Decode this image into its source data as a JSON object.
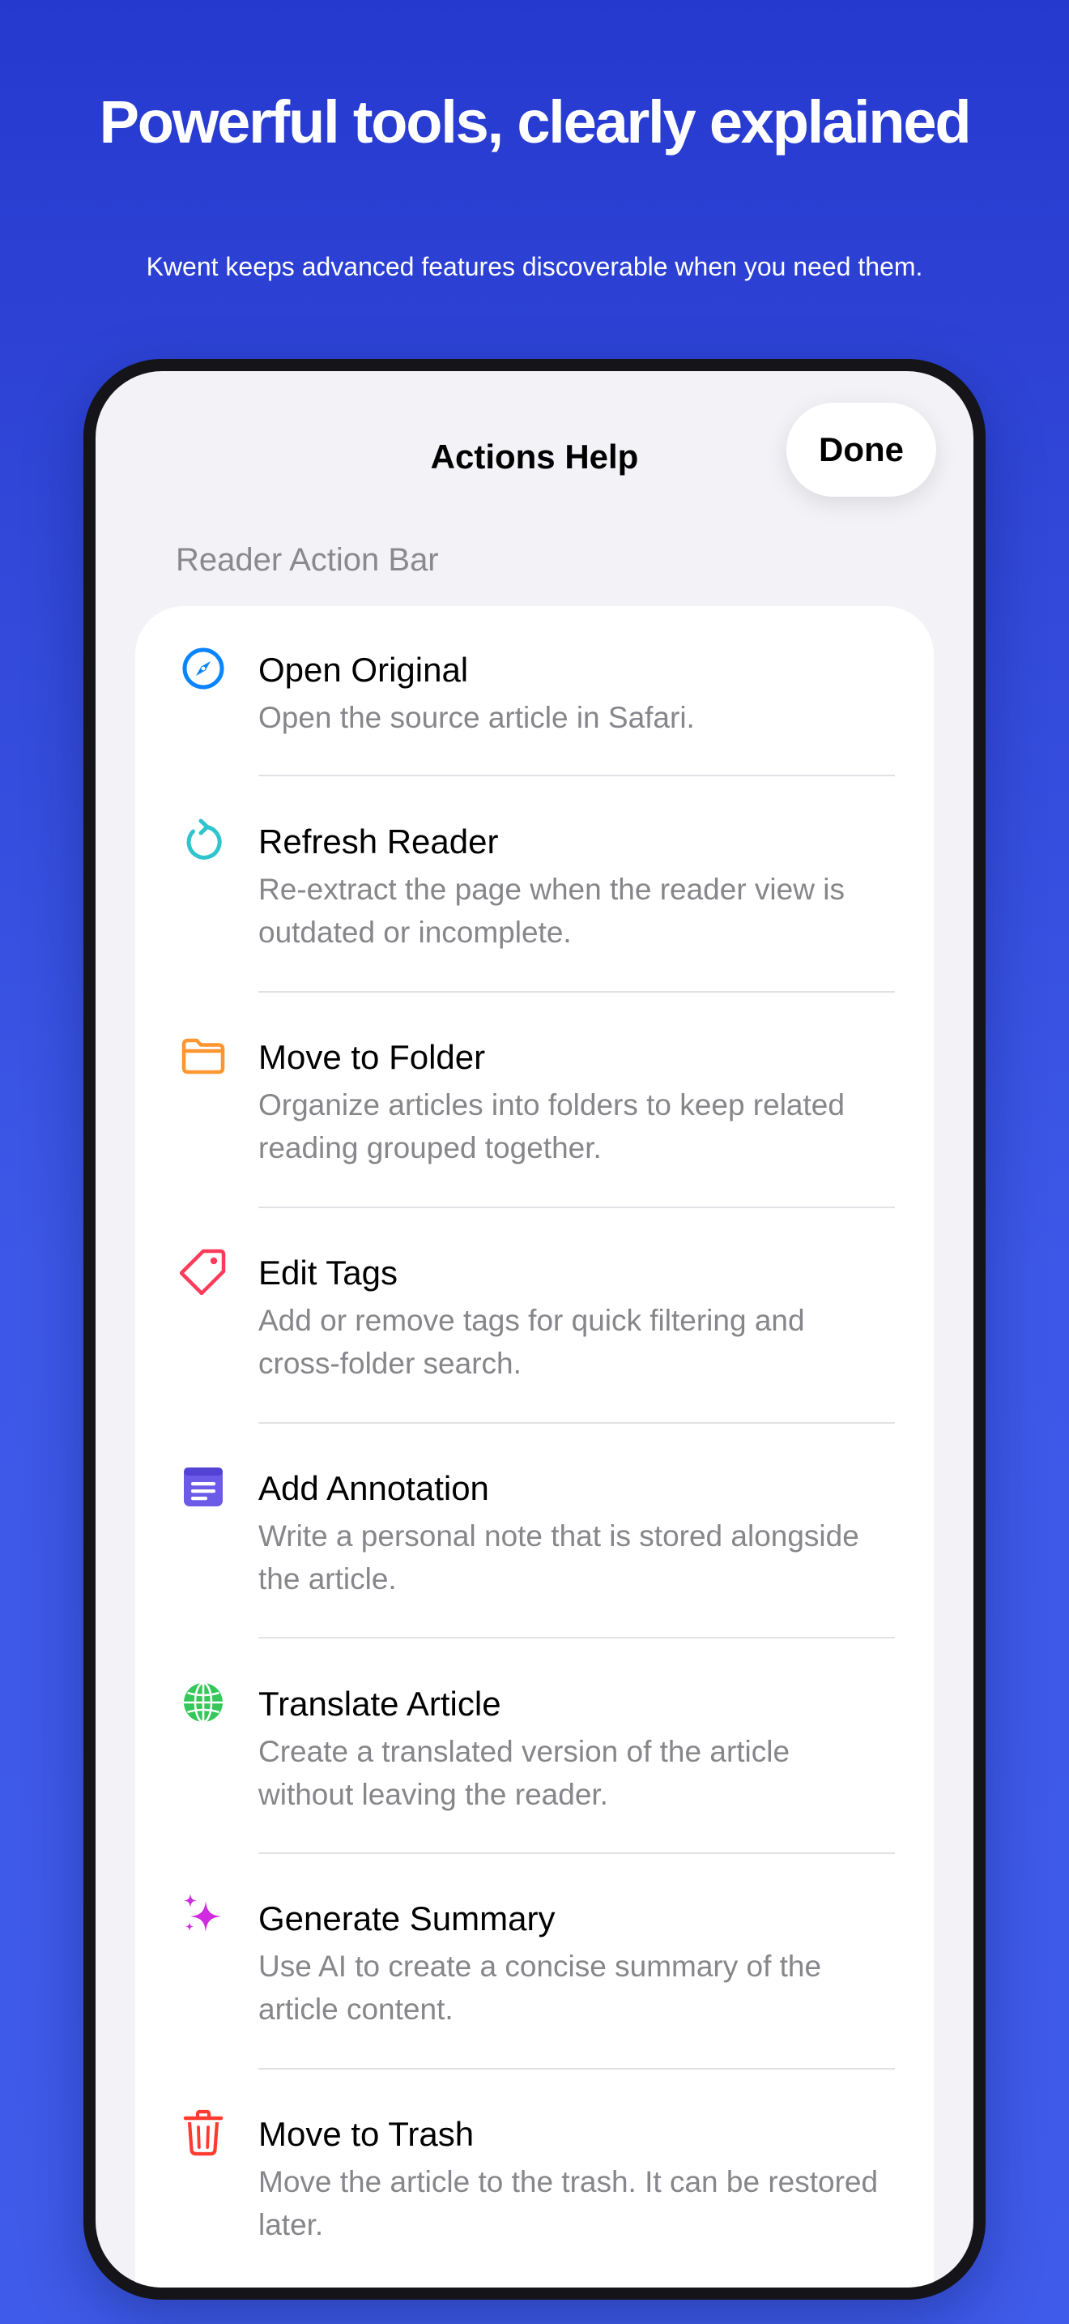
{
  "headline": "Powerful tools, clearly explained",
  "subhead": "Kwent keeps advanced features discoverable when you need them.",
  "sheet": {
    "title": "Actions Help",
    "done_label": "Done"
  },
  "section": {
    "header": "Reader Action Bar"
  },
  "actions": [
    {
      "icon": "compass-icon",
      "color": "#0a84ff",
      "title": "Open Original",
      "desc": "Open the source article in Safari."
    },
    {
      "icon": "refresh-icon",
      "color": "#30c5cc",
      "title": "Refresh Reader",
      "desc": "Re-extract the page when the reader view is outdated or incomplete."
    },
    {
      "icon": "folder-icon",
      "color": "#ff9630",
      "title": "Move to Folder",
      "desc": "Organize articles into folders to keep related reading grouped together."
    },
    {
      "icon": "tag-icon",
      "color": "#ff3b5c",
      "title": "Edit Tags",
      "desc": "Add or remove tags for quick filtering and cross-folder search."
    },
    {
      "icon": "note-icon",
      "color": "#6b5be8",
      "title": "Add Annotation",
      "desc": "Write a personal note that is stored alongside the article."
    },
    {
      "icon": "globe-icon",
      "color": "#34c759",
      "title": "Translate Article",
      "desc": "Create a translated version of the article without leaving the reader."
    },
    {
      "icon": "sparkles-icon",
      "color": "#d02be0",
      "title": "Generate Summary",
      "desc": "Use AI to create a concise summary of the article content."
    },
    {
      "icon": "trash-icon",
      "color": "#ff3b30",
      "title": "Move to Trash",
      "desc": "Move the article to the trash. It can be restored later."
    }
  ]
}
